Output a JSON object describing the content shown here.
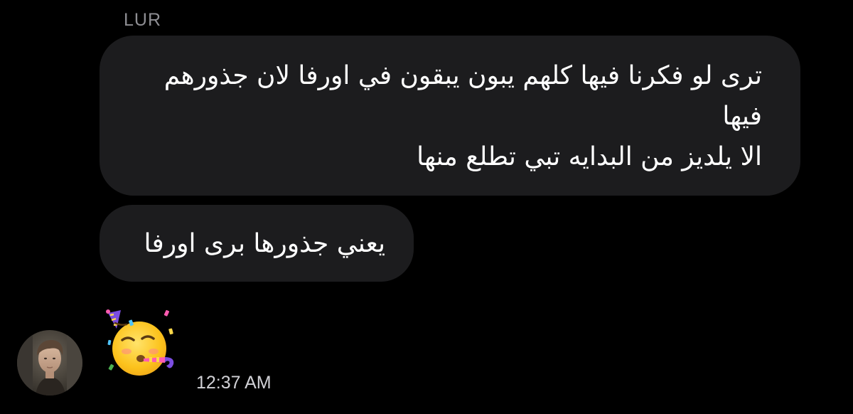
{
  "conversation": {
    "sender_name": "LUR",
    "messages": [
      {
        "lines": [
          "ترى لو فكرنا فيها كلهم يبون يبقون في اورفا لان جذورهم",
          "فيها",
          "الا يلديز من البدايه تبي تطلع منها"
        ]
      },
      {
        "lines": [
          "يعني جذورها برى اورفا"
        ]
      }
    ],
    "reaction_emoji": "partying-face-icon",
    "timestamp": "12:37 AM"
  },
  "colors": {
    "background": "#000000",
    "bubble": "#1c1c1e",
    "sender_name": "#8e8e93",
    "message_text": "#ffffff",
    "timestamp": "#d1d1d6"
  }
}
